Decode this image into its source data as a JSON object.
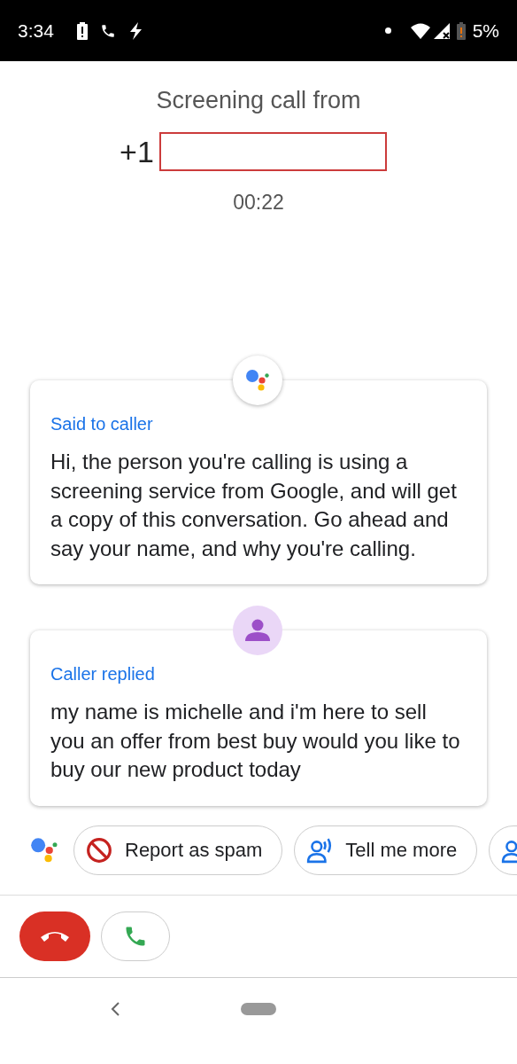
{
  "status_bar": {
    "time": "3:34",
    "battery": "5%"
  },
  "header": {
    "title": "Screening call from",
    "number_prefix": "+1",
    "number_redacted": true,
    "timer": "00:22"
  },
  "messages": [
    {
      "kind": "assistant",
      "label": "Said to caller",
      "text": "Hi, the person you're calling is using a screening service from Google, and will get a copy of this conversation. Go ahead and say your name, and why you're calling."
    },
    {
      "kind": "caller",
      "label": "Caller replied",
      "text": "my name is michelle and i'm here to sell you an offer from best buy would you like to buy our new product today"
    }
  ],
  "suggestions": [
    {
      "kind": "block",
      "label": "Report as spam"
    },
    {
      "kind": "speaker",
      "label": "Tell me more"
    },
    {
      "kind": "person"
    }
  ],
  "call_buttons": [
    {
      "kind": "hangup"
    },
    {
      "kind": "answer"
    }
  ]
}
